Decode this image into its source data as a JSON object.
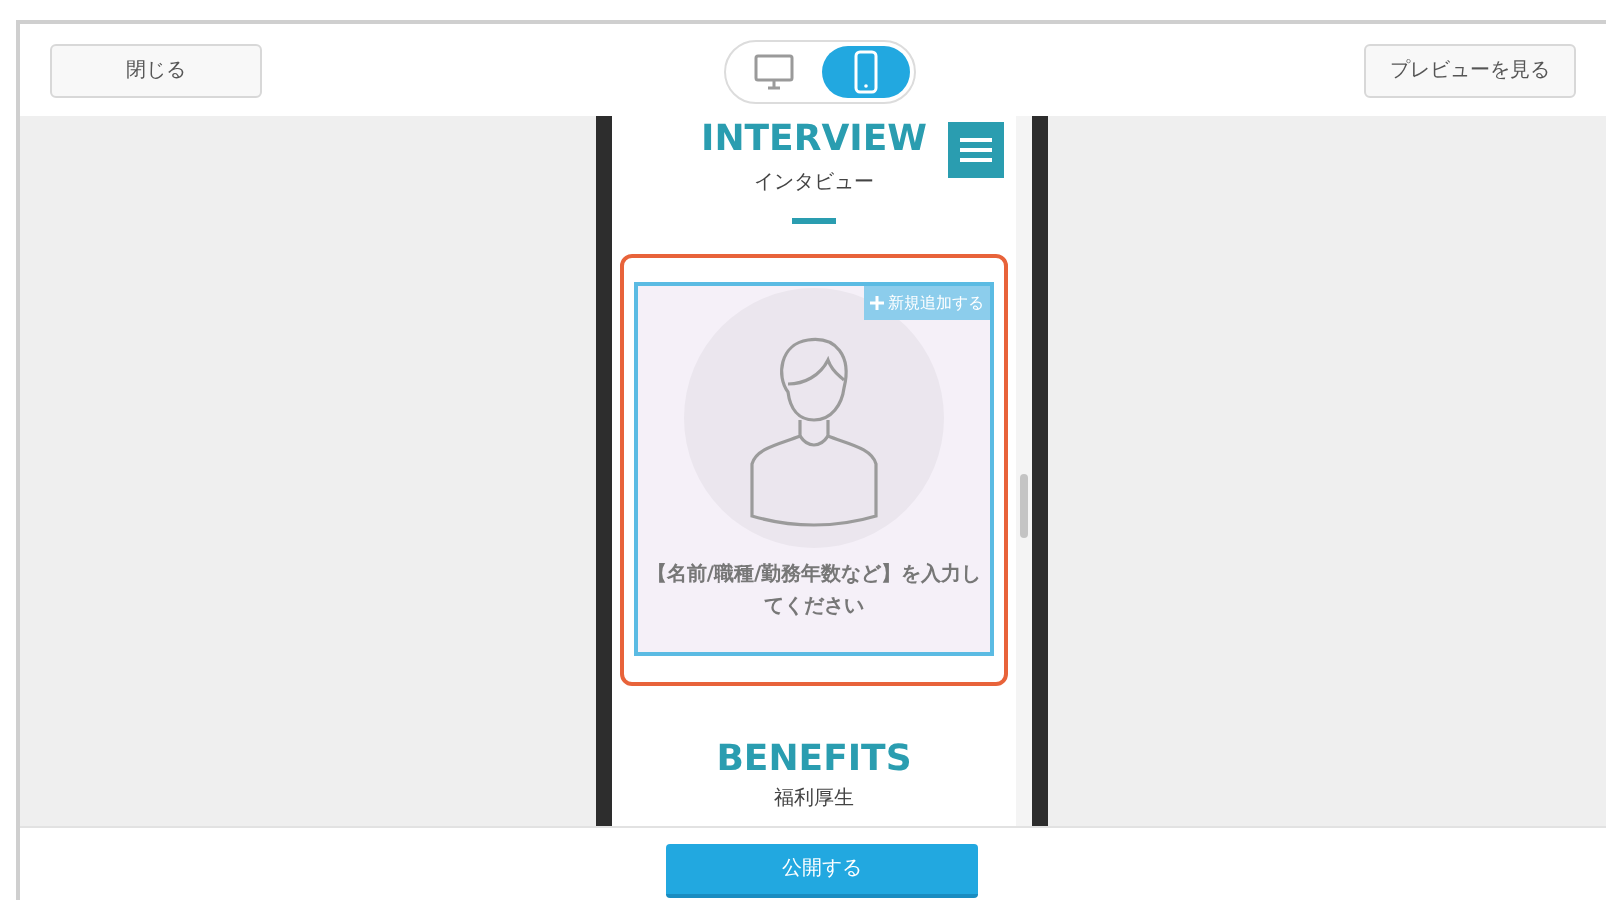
{
  "header": {
    "close_button": "閉じる",
    "preview_button": "プレビューを見る",
    "device_tabs": [
      {
        "kind": "desktop",
        "selected": false
      },
      {
        "kind": "mobile",
        "selected": true
      }
    ]
  },
  "phone": {
    "interview": {
      "title": "INTERVIEW",
      "subtitle": "インタビュー"
    },
    "card": {
      "add_label": "新規追加する",
      "placeholder_text": "【名前/職種/勤務年数など】を入力してください"
    },
    "benefits": {
      "title": "BENEFITS",
      "subtitle": "福利厚生"
    }
  },
  "footer": {
    "publish_button": "公開する"
  }
}
